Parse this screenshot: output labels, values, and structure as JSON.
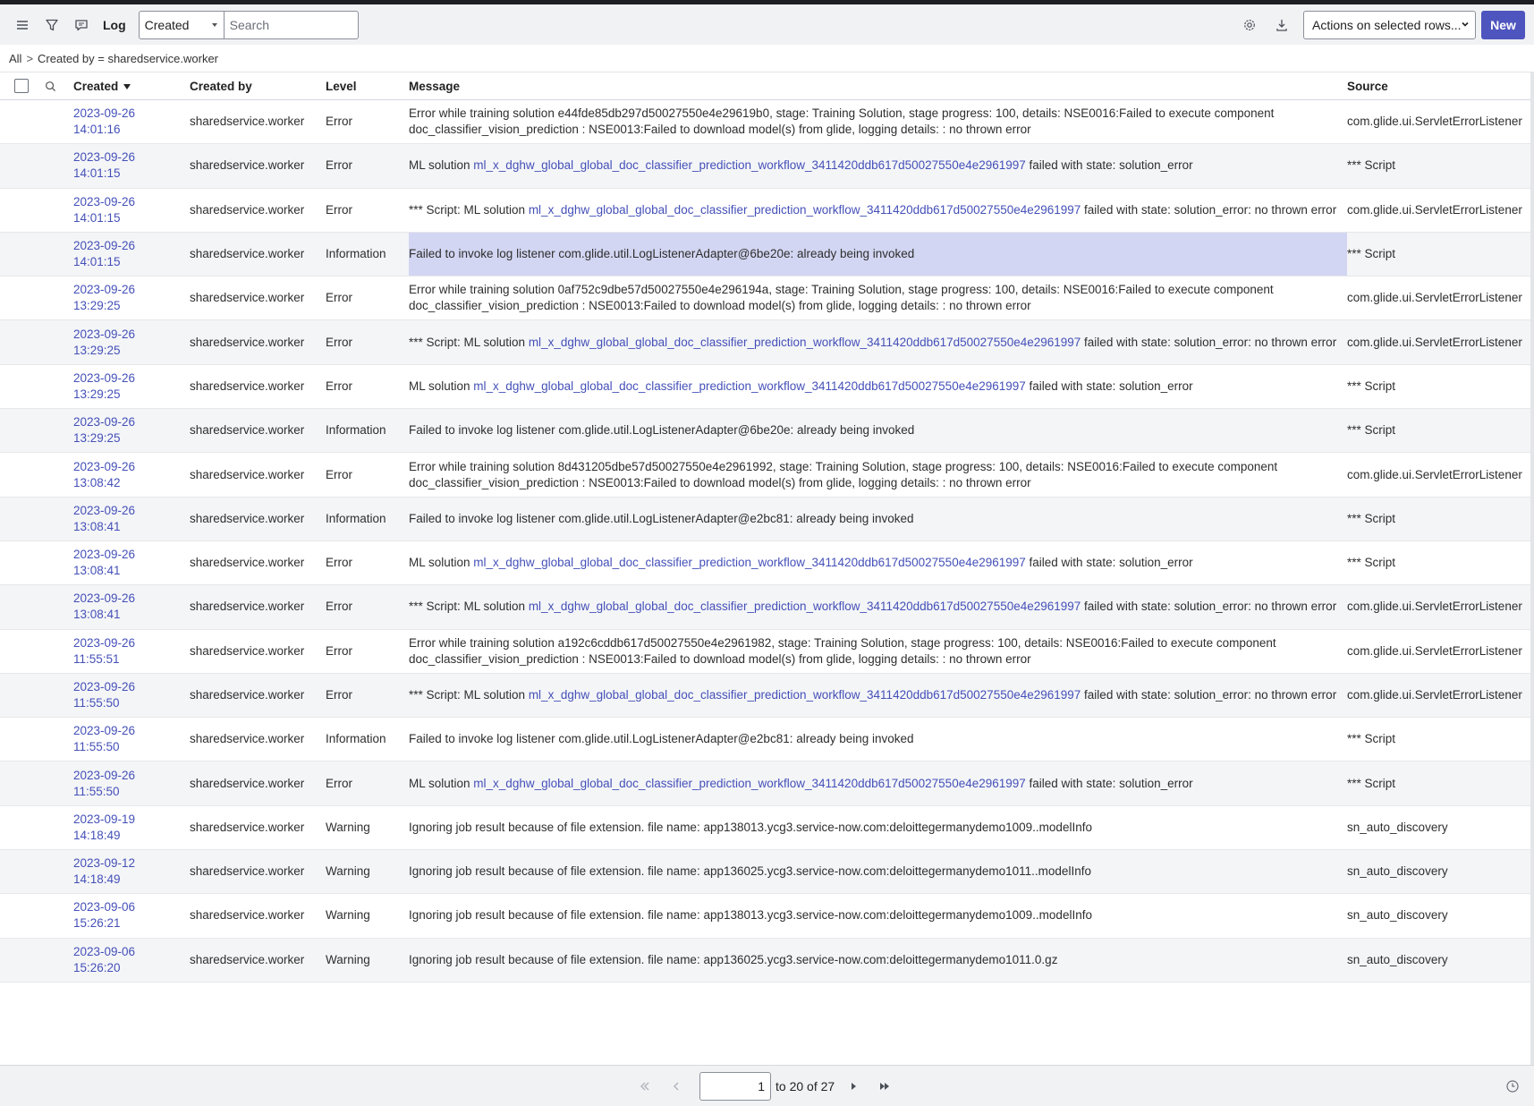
{
  "toolbar": {
    "title": "Log",
    "field_select": "Created",
    "search_placeholder": "Search",
    "actions_select": "Actions on selected rows...",
    "new_label": "New"
  },
  "breadcrumb": {
    "all": "All",
    "separator": ">",
    "filter": "Created by = sharedservice.worker"
  },
  "columns": {
    "created": "Created",
    "created_by": "Created by",
    "level": "Level",
    "message": "Message",
    "source": "Source"
  },
  "rows": [
    {
      "date": "2023-09-26",
      "time": "14:01:16",
      "by": "sharedservice.worker",
      "level": "Error",
      "msg_pre": "Error while training solution e44fde85db297d50027550e4e29619b0, stage: Training Solution, stage progress: 100, details: NSE0016:Failed to execute component doc_classifier_vision_prediction : NSE0013:Failed to download model(s) from glide, logging details: : no thrown error",
      "msg_link": "",
      "msg_post": "",
      "source": "com.glide.ui.ServletErrorListener"
    },
    {
      "date": "2023-09-26",
      "time": "14:01:15",
      "by": "sharedservice.worker",
      "level": "Error",
      "msg_pre": "ML solution ",
      "msg_link": "ml_x_dghw_global_global_doc_classifier_prediction_workflow_3411420ddb617d50027550e4e2961997",
      "msg_post": " failed with state: solution_error",
      "source": "*** Script"
    },
    {
      "date": "2023-09-26",
      "time": "14:01:15",
      "by": "sharedservice.worker",
      "level": "Error",
      "msg_pre": "*** Script: ML solution ",
      "msg_link": "ml_x_dghw_global_global_doc_classifier_prediction_workflow_3411420ddb617d50027550e4e2961997",
      "msg_post": " failed with state: solution_error: no thrown error",
      "source": "com.glide.ui.ServletErrorListener"
    },
    {
      "date": "2023-09-26",
      "time": "14:01:15",
      "by": "sharedservice.worker",
      "level": "Information",
      "msg_pre": "Failed to invoke log listener com.glide.util.LogListenerAdapter@6be20e: already being invoked",
      "msg_link": "",
      "msg_post": "",
      "source": "*** Script"
    },
    {
      "date": "2023-09-26",
      "time": "13:29:25",
      "by": "sharedservice.worker",
      "level": "Error",
      "msg_pre": "Error while training solution 0af752c9dbe57d50027550e4e296194a, stage: Training Solution, stage progress: 100, details: NSE0016:Failed to execute component doc_classifier_vision_prediction : NSE0013:Failed to download model(s) from glide, logging details: : no thrown error",
      "msg_link": "",
      "msg_post": "",
      "source": "com.glide.ui.ServletErrorListener"
    },
    {
      "date": "2023-09-26",
      "time": "13:29:25",
      "by": "sharedservice.worker",
      "level": "Error",
      "msg_pre": "*** Script: ML solution ",
      "msg_link": "ml_x_dghw_global_global_doc_classifier_prediction_workflow_3411420ddb617d50027550e4e2961997",
      "msg_post": " failed with state: solution_error: no thrown error",
      "source": "com.glide.ui.ServletErrorListener"
    },
    {
      "date": "2023-09-26",
      "time": "13:29:25",
      "by": "sharedservice.worker",
      "level": "Error",
      "msg_pre": "ML solution ",
      "msg_link": "ml_x_dghw_global_global_doc_classifier_prediction_workflow_3411420ddb617d50027550e4e2961997",
      "msg_post": " failed with state: solution_error",
      "source": "*** Script"
    },
    {
      "date": "2023-09-26",
      "time": "13:29:25",
      "by": "sharedservice.worker",
      "level": "Information",
      "msg_pre": "Failed to invoke log listener com.glide.util.LogListenerAdapter@6be20e: already being invoked",
      "msg_link": "",
      "msg_post": "",
      "source": "*** Script"
    },
    {
      "date": "2023-09-26",
      "time": "13:08:42",
      "by": "sharedservice.worker",
      "level": "Error",
      "msg_pre": "Error while training solution 8d431205dbe57d50027550e4e2961992, stage: Training Solution, stage progress: 100, details: NSE0016:Failed to execute component doc_classifier_vision_prediction : NSE0013:Failed to download model(s) from glide, logging details: : no thrown error",
      "msg_link": "",
      "msg_post": "",
      "source": "com.glide.ui.ServletErrorListener"
    },
    {
      "date": "2023-09-26",
      "time": "13:08:41",
      "by": "sharedservice.worker",
      "level": "Information",
      "msg_pre": "Failed to invoke log listener com.glide.util.LogListenerAdapter@e2bc81: already being invoked",
      "msg_link": "",
      "msg_post": "",
      "source": "*** Script"
    },
    {
      "date": "2023-09-26",
      "time": "13:08:41",
      "by": "sharedservice.worker",
      "level": "Error",
      "msg_pre": "ML solution ",
      "msg_link": "ml_x_dghw_global_global_doc_classifier_prediction_workflow_3411420ddb617d50027550e4e2961997",
      "msg_post": " failed with state: solution_error",
      "source": "*** Script"
    },
    {
      "date": "2023-09-26",
      "time": "13:08:41",
      "by": "sharedservice.worker",
      "level": "Error",
      "msg_pre": "*** Script: ML solution ",
      "msg_link": "ml_x_dghw_global_global_doc_classifier_prediction_workflow_3411420ddb617d50027550e4e2961997",
      "msg_post": " failed with state: solution_error: no thrown error",
      "source": "com.glide.ui.ServletErrorListener"
    },
    {
      "date": "2023-09-26",
      "time": "11:55:51",
      "by": "sharedservice.worker",
      "level": "Error",
      "msg_pre": "Error while training solution a192c6cddb617d50027550e4e2961982, stage: Training Solution, stage progress: 100, details: NSE0016:Failed to execute component doc_classifier_vision_prediction : NSE0013:Failed to download model(s) from glide, logging details: : no thrown error",
      "msg_link": "",
      "msg_post": "",
      "source": "com.glide.ui.ServletErrorListener"
    },
    {
      "date": "2023-09-26",
      "time": "11:55:50",
      "by": "sharedservice.worker",
      "level": "Error",
      "msg_pre": "*** Script: ML solution ",
      "msg_link": "ml_x_dghw_global_global_doc_classifier_prediction_workflow_3411420ddb617d50027550e4e2961997",
      "msg_post": " failed with state: solution_error: no thrown error",
      "source": "com.glide.ui.ServletErrorListener"
    },
    {
      "date": "2023-09-26",
      "time": "11:55:50",
      "by": "sharedservice.worker",
      "level": "Information",
      "msg_pre": "Failed to invoke log listener com.glide.util.LogListenerAdapter@e2bc81: already being invoked",
      "msg_link": "",
      "msg_post": "",
      "source": "*** Script"
    },
    {
      "date": "2023-09-26",
      "time": "11:55:50",
      "by": "sharedservice.worker",
      "level": "Error",
      "msg_pre": "ML solution ",
      "msg_link": "ml_x_dghw_global_global_doc_classifier_prediction_workflow_3411420ddb617d50027550e4e2961997",
      "msg_post": " failed with state: solution_error",
      "source": "*** Script"
    },
    {
      "date": "2023-09-19",
      "time": "14:18:49",
      "by": "sharedservice.worker",
      "level": "Warning",
      "msg_pre": "Ignoring job result because of file extension. file name: app138013.ycg3.service-now.com:deloittegermanydemo1009..modelInfo",
      "msg_link": "",
      "msg_post": "",
      "source": "sn_auto_discovery"
    },
    {
      "date": "2023-09-12",
      "time": "14:18:49",
      "by": "sharedservice.worker",
      "level": "Warning",
      "msg_pre": "Ignoring job result because of file extension. file name: app136025.ycg3.service-now.com:deloittegermanydemo1011..modelInfo",
      "msg_link": "",
      "msg_post": "",
      "source": "sn_auto_discovery"
    },
    {
      "date": "2023-09-06",
      "time": "15:26:21",
      "by": "sharedservice.worker",
      "level": "Warning",
      "msg_pre": "Ignoring job result because of file extension. file name: app138013.ycg3.service-now.com:deloittegermanydemo1009..modelInfo",
      "msg_link": "",
      "msg_post": "",
      "source": "sn_auto_discovery"
    },
    {
      "date": "2023-09-06",
      "time": "15:26:20",
      "by": "sharedservice.worker",
      "level": "Warning",
      "msg_pre": "Ignoring job result because of file extension. file name: app136025.ycg3.service-now.com:deloittegermanydemo1011.0.gz",
      "msg_link": "",
      "msg_post": "",
      "source": "sn_auto_discovery"
    }
  ],
  "selected_row_index": 3,
  "pager": {
    "current_value": "1",
    "range_text": "to 20 of 27"
  },
  "colors": {
    "accent": "#4e55be",
    "link": "#4450b8",
    "selected_cell": "#d3d6f2",
    "toolbar_bg": "#f1f2f4"
  },
  "icons": [
    "menu-icon",
    "filter-icon",
    "comment-icon",
    "gear-icon",
    "download-icon",
    "search-icon",
    "first-page-icon",
    "prev-page-icon",
    "next-page-icon",
    "last-page-icon",
    "clock-icon"
  ]
}
